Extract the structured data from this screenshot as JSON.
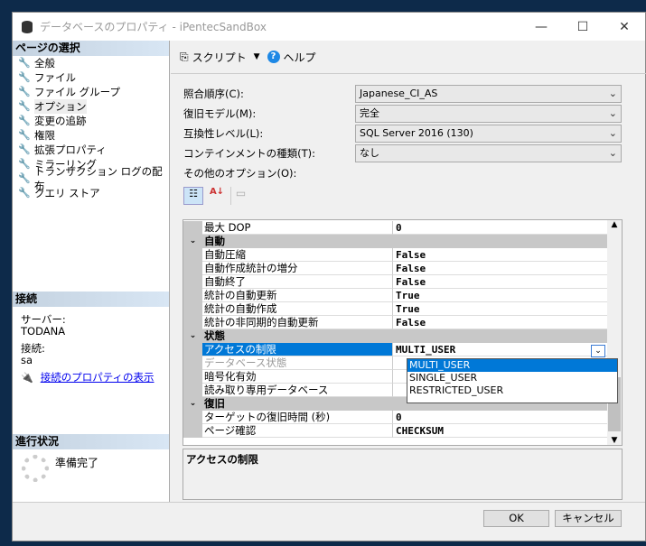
{
  "window": {
    "title": "データベースのプロパティ - iPentecSandBox"
  },
  "left": {
    "select_page_header": "ページの選択",
    "pages": [
      "全般",
      "ファイル",
      "ファイル グループ",
      "オプション",
      "変更の追跡",
      "権限",
      "拡張プロパティ",
      "ミラーリング",
      "トランザクション ログの配布",
      "クエリ ストア"
    ],
    "connection_header": "接続",
    "server_label": "サーバー:",
    "server_value": "TODANA",
    "conn_label": "接続:",
    "conn_value": "sa",
    "conn_link": "接続のプロパティの表示",
    "progress_header": "進行状況",
    "progress_status": "準備完了"
  },
  "toolbar": {
    "script": "スクリプト",
    "help": "ヘルプ"
  },
  "form": {
    "collation_label": "照合順序(C):",
    "collation_value": "Japanese_CI_AS",
    "recovery_label": "復旧モデル(M):",
    "recovery_value": "完全",
    "compat_label": "互換性レベル(L):",
    "compat_value": "SQL Server 2016 (130)",
    "containment_label": "コンテインメントの種類(T):",
    "containment_value": "なし",
    "other_label": "その他のオプション(O):"
  },
  "grid": {
    "rows": [
      {
        "name": "最大 DOP",
        "value": "0"
      },
      {
        "cat": "自動"
      },
      {
        "name": "自動圧縮",
        "value": "False"
      },
      {
        "name": "自動作成統計の増分",
        "value": "False"
      },
      {
        "name": "自動終了",
        "value": "False"
      },
      {
        "name": "統計の自動更新",
        "value": "True"
      },
      {
        "name": "統計の自動作成",
        "value": "True"
      },
      {
        "name": "統計の非同期的自動更新",
        "value": "False"
      },
      {
        "cat": "状態"
      },
      {
        "name": "アクセスの制限",
        "value": "MULTI_USER"
      },
      {
        "name": "データベース状態",
        "value": ""
      },
      {
        "name": "暗号化有効",
        "value": ""
      },
      {
        "name": "読み取り専用データベース",
        "value": ""
      },
      {
        "cat": "復旧"
      },
      {
        "name": "ターゲットの復旧時間 (秒)",
        "value": "0"
      },
      {
        "name": "ページ確認",
        "value": "CHECKSUM"
      }
    ],
    "dropdown_options": [
      "MULTI_USER",
      "SINGLE_USER",
      "RESTRICTED_USER"
    ],
    "description_title": "アクセスの制限"
  },
  "buttons": {
    "ok": "OK",
    "cancel": "キャンセル"
  }
}
